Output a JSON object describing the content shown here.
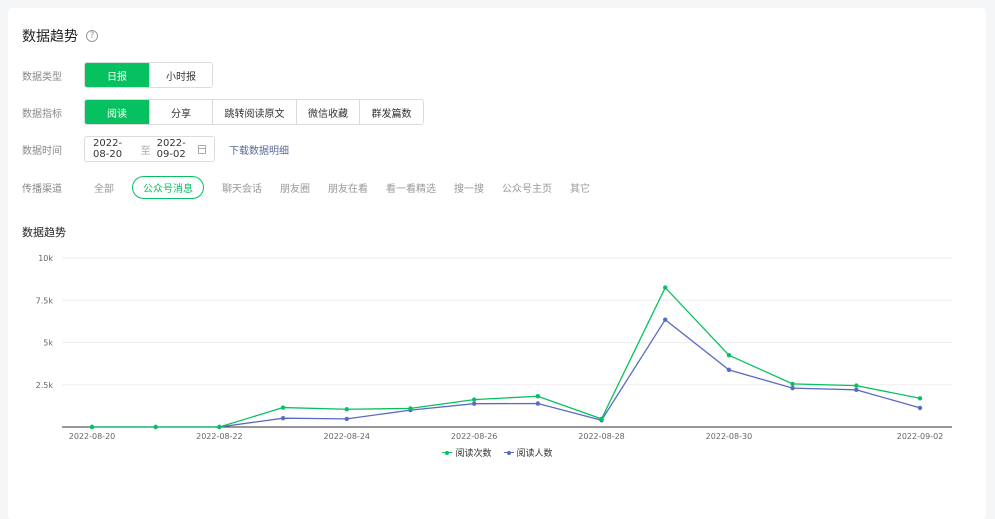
{
  "header": {
    "title": "数据趋势",
    "help_icon": "question-circle-icon"
  },
  "filters": {
    "data_type": {
      "label": "数据类型",
      "options": [
        "日报",
        "小时报"
      ],
      "selected": 0
    },
    "metric": {
      "label": "数据指标",
      "options": [
        "阅读",
        "分享",
        "跳转阅读原文",
        "微信收藏",
        "群发篇数"
      ],
      "selected": 0
    },
    "date": {
      "label": "数据时间",
      "start": "2022-08-20",
      "sep": "至",
      "end": "2022-09-02",
      "download": "下载数据明细",
      "calendar_icon": "calendar-icon"
    },
    "channel": {
      "label": "传播渠道",
      "options": [
        "全部",
        "公众号消息",
        "聊天会话",
        "朋友圈",
        "朋友在看",
        "看一看精选",
        "搜一搜",
        "公众号主页",
        "其它"
      ],
      "selected": 1
    }
  },
  "chart_title": "数据趋势",
  "colors": {
    "accent": "#07c160",
    "series2": "#5b6bc0",
    "link": "#576b95"
  },
  "chart_data": {
    "type": "line",
    "x": [
      "2022-08-20",
      "2022-08-21",
      "2022-08-22",
      "2022-08-23",
      "2022-08-24",
      "2022-08-25",
      "2022-08-26",
      "2022-08-27",
      "2022-08-28",
      "2022-08-29",
      "2022-08-30",
      "2022-08-31",
      "2022-09-01",
      "2022-09-02"
    ],
    "x_tick_labels": [
      "2022-08-20",
      "2022-08-22",
      "2022-08-24",
      "2022-08-26",
      "2022-08-28",
      "2022-08-30",
      "2022-09-02"
    ],
    "y_tick_labels": [
      "10k",
      "7.5k",
      "5k",
      "2.5k"
    ],
    "ylim": [
      0,
      10000
    ],
    "grid": true,
    "legend": "bottom",
    "series": [
      {
        "name": "阅读次数",
        "color": "#07c160",
        "values": [
          0,
          0,
          0,
          1150,
          1050,
          1100,
          1620,
          1820,
          480,
          8250,
          4250,
          2550,
          2450,
          1700
        ]
      },
      {
        "name": "阅读人数",
        "color": "#5b6bc0",
        "values": [
          0,
          0,
          0,
          520,
          480,
          1000,
          1380,
          1390,
          400,
          6350,
          3380,
          2300,
          2200,
          1130
        ]
      }
    ]
  }
}
